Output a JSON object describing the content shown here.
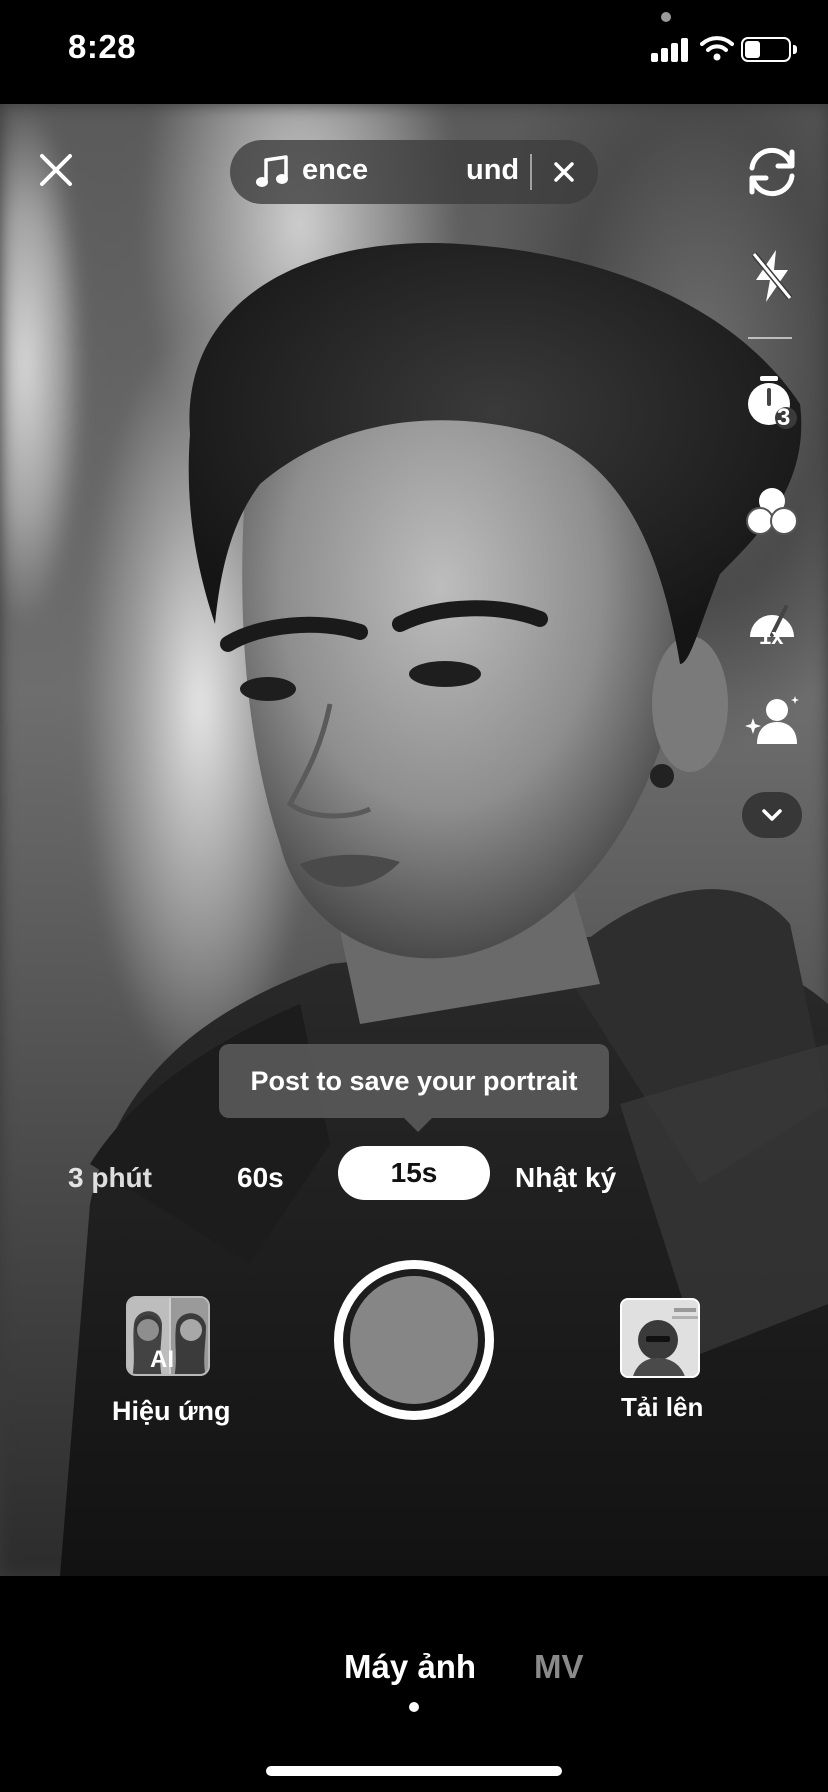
{
  "status_bar": {
    "time": "8:28",
    "icons": [
      "cellular-signal-icon",
      "wifi-icon",
      "battery-icon"
    ],
    "battery_level": 0.35
  },
  "top_controls": {
    "close_icon": "close-icon",
    "sound": {
      "icon": "music-note-icon",
      "text_left": "ence",
      "text_right": "und",
      "remove_icon": "close-icon"
    },
    "flip_icon": "flip-camera-icon"
  },
  "side_tools": [
    {
      "icon": "flash-off-icon"
    },
    {
      "icon": "timer-icon",
      "badge": "3"
    },
    {
      "icon": "filters-icon"
    },
    {
      "icon": "speed-icon",
      "badge": "1x"
    },
    {
      "icon": "ai-avatar-icon"
    },
    {
      "icon": "chevron-down-icon"
    }
  ],
  "tooltip": "Post to save your portrait",
  "durations": {
    "items": [
      "3 phút",
      "60s",
      "15s",
      "Nhật ký"
    ],
    "selected": "15s"
  },
  "effects": {
    "badge": "AI",
    "label": "Hiệu ứng"
  },
  "upload": {
    "label": "Tải lên"
  },
  "bottom_tabs": {
    "camera": "Máy ảnh",
    "mv": "MV",
    "active": "Máy ảnh"
  },
  "colors": {
    "background": "#000000",
    "pill": "#3c3c3c",
    "shutter_inner": "#868686",
    "inactive_tab": "#8a8a8a"
  }
}
